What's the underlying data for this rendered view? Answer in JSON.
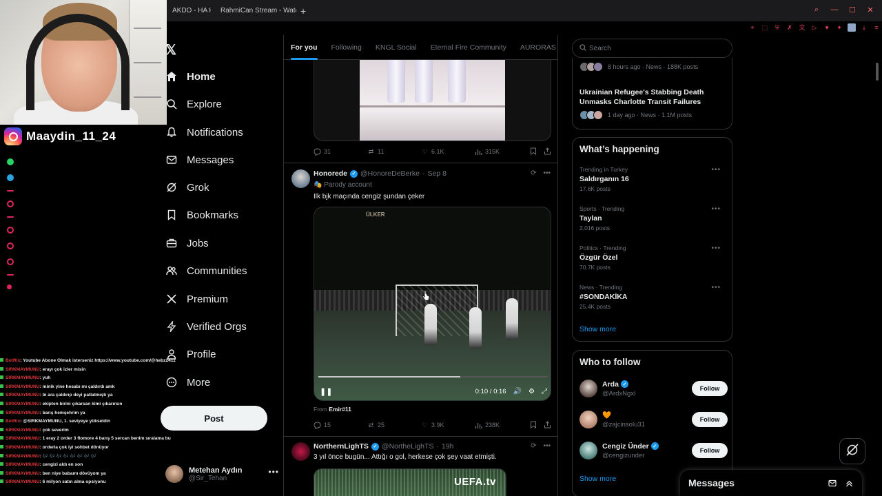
{
  "browser": {
    "tabs": [
      {
        "label": "AKDO - HA HA"
      },
      {
        "label": "RahmiCan Stream - Watch"
      }
    ],
    "new_tab_icon": "plus-icon"
  },
  "stream_overlay": {
    "instagram_handle": "Maaydin_11_24",
    "chat": [
      {
        "user": "BotRix",
        "message": ": Youtube Abone Olmak isterseniz https://www.youtube.com/@hebz2411"
      },
      {
        "user": "SIRKMAYMUNU",
        "message": ": erayı çok izler misin"
      },
      {
        "user": "SIRKMAYMUNU",
        "message": ": yuh"
      },
      {
        "user": "SIRKMAYMUNU",
        "message": ": minik yine hesabı mı çaldırdı amk"
      },
      {
        "user": "SIRKMAYMUNU",
        "message": ": bi ara çaldırıp deyi patlatmıştı ya"
      },
      {
        "user": "SIRKMAYMUNU",
        "message": ": ekipten birini çıkarsan kimi çıkarırsın"
      },
      {
        "user": "SIRKMAYMUNU",
        "message": ": barış hemşehrim ya"
      },
      {
        "user": "BotRix",
        "message": ": @SIRKMAYMUNU, 1. seviyeye yükseldin"
      },
      {
        "user": "SIRKMAYMUNU",
        "message": ": çok severim"
      },
      {
        "user": "SIRKMAYMUNU",
        "message": ": 1 eray 2 order 3 flomore 4 barış 5 sercan benim sıralama bu"
      },
      {
        "user": "SIRKMAYMUNU",
        "message": ": orderla çok iyi sohbet dönüyor"
      },
      {
        "user": "SIRKMAYMUNU",
        "message": ": 🎶 🎶 🎶 🎶 🎶 🎶 🎶 🎶"
      },
      {
        "user": "SIRKMAYMUNU",
        "message": ": cengizi aldı en son"
      },
      {
        "user": "SIRKMAYMUNU",
        "message": ": ben niye babamı dövüyom ya"
      },
      {
        "user": "SIRKMAYMUNU",
        "message": ": 6 milyon satın alma opsiyonu"
      }
    ]
  },
  "nav": {
    "items": [
      {
        "label": "Home",
        "icon": "home-icon",
        "active": true
      },
      {
        "label": "Explore",
        "icon": "search-icon"
      },
      {
        "label": "Notifications",
        "icon": "bell-icon"
      },
      {
        "label": "Messages",
        "icon": "envelope-icon"
      },
      {
        "label": "Grok",
        "icon": "grok-icon"
      },
      {
        "label": "Bookmarks",
        "icon": "bookmark-icon"
      },
      {
        "label": "Jobs",
        "icon": "briefcase-icon"
      },
      {
        "label": "Communities",
        "icon": "people-icon"
      },
      {
        "label": "Premium",
        "icon": "x-icon"
      },
      {
        "label": "Verified Orgs",
        "icon": "lightning-icon"
      },
      {
        "label": "Profile",
        "icon": "person-icon"
      },
      {
        "label": "More",
        "icon": "more-circle-icon"
      }
    ],
    "post_label": "Post",
    "account": {
      "name": "Metehan Aydın",
      "handle": "@Sir_Tehan"
    }
  },
  "feed": {
    "tabs": [
      "For you",
      "Following",
      "KNGL Social",
      "Eternal Fire Community",
      "AURORAS"
    ],
    "top_tweet_stats": {
      "replies": "31",
      "reposts": "11",
      "likes": "6.1K",
      "views": "315K"
    },
    "tweet1": {
      "name": "Honorede",
      "handle": "@HonoreDeBerke",
      "date": "Sep 8",
      "label": "Parody account",
      "text": "Ilk bjk maçında cengiz şundan çeker",
      "video": {
        "sponsor": "ÜLKER",
        "time": "0:10 / 0:16",
        "progress": 0.62
      },
      "from_prefix": "From",
      "from_user": "Emir#11",
      "stats": {
        "replies": "15",
        "reposts": "25",
        "likes": "3.9K",
        "views": "238K"
      }
    },
    "tweet2": {
      "name": "NorthernLighTS",
      "handle": "@NortheLighTS",
      "date": "19h",
      "text": "3 yıl önce bugün... Attığı o gol, herkese çok şey vaat etmişti.",
      "media_caption": "UEFA.tv"
    }
  },
  "sidebar": {
    "search_placeholder": "Search",
    "news": [
      {
        "meta": "8 hours ago · News · 188K posts",
        "title": ""
      },
      {
        "title": "Ukrainian Refugee's Stabbing Death Unmasks Charlotte Transit Failures",
        "meta": "1 day ago · News · 1.1M posts"
      }
    ],
    "whats_happening": {
      "title": "What’s happening",
      "trends": [
        {
          "context": "Trending in Turkey",
          "name": "Saldırganın 16",
          "posts": "17.6K posts"
        },
        {
          "context": "Sports · Trending",
          "name": "Taylan",
          "posts": "2,016 posts"
        },
        {
          "context": "Politics · Trending",
          "name": "Özgür Özel",
          "posts": "70.7K posts"
        },
        {
          "context": "News · Trending",
          "name": "#SONDAKİKA",
          "posts": "25.4K posts"
        }
      ],
      "show_more": "Show more"
    },
    "who_to_follow": {
      "title": "Who to follow",
      "accounts": [
        {
          "name": "Arda",
          "handle": "@ArdxNgxl",
          "verified": true
        },
        {
          "name": "🧡",
          "handle": "@zajcinsolu31",
          "verified": false
        },
        {
          "name": "Cengiz Ünder",
          "handle": "@cengizunder",
          "verified": true
        }
      ],
      "follow_label": "Follow",
      "show_more": "Show more"
    }
  },
  "messages_drawer": {
    "title": "Messages"
  },
  "colors": {
    "accent": "#1d9bf0",
    "background": "#000000",
    "border": "#2f3336",
    "muted": "#71767b"
  }
}
